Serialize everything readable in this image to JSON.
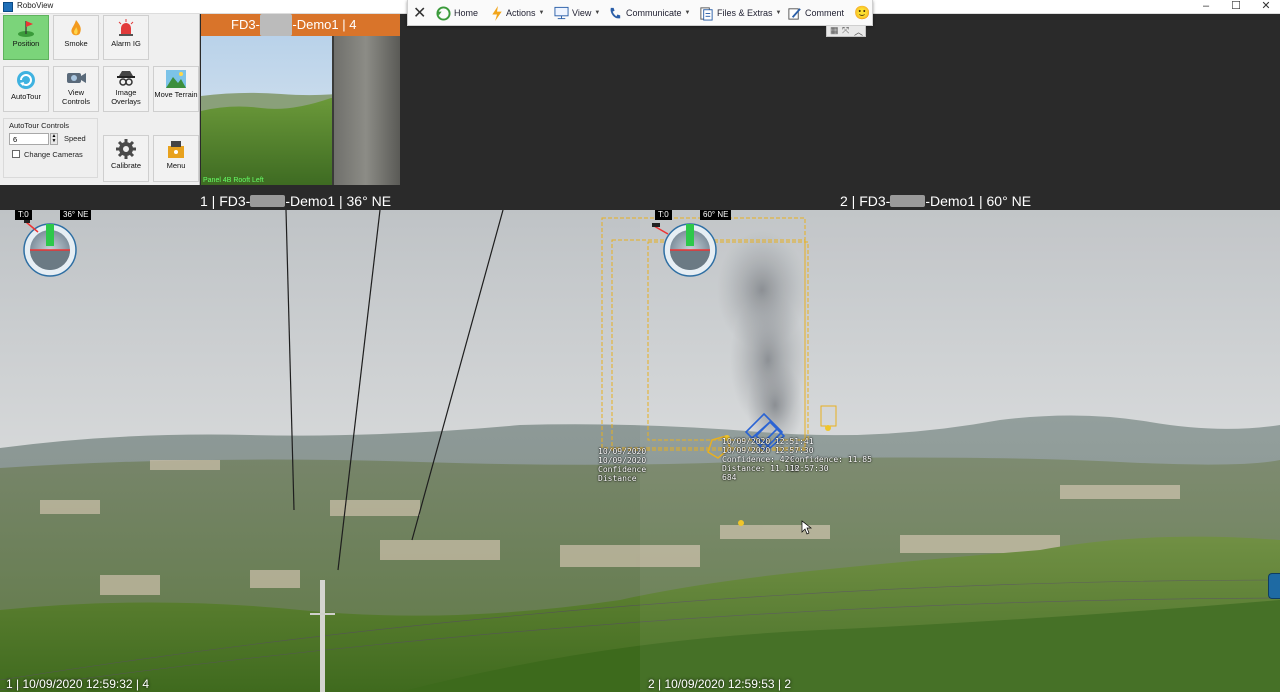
{
  "window": {
    "title": "RoboView",
    "minimize": "–",
    "maximize": "☐",
    "close": "✕"
  },
  "toolbar": {
    "close": "✕",
    "items": [
      {
        "label": "Home",
        "icon": "home-icon"
      },
      {
        "label": "Actions",
        "icon": "lightning-icon"
      },
      {
        "label": "View",
        "icon": "monitor-icon"
      },
      {
        "label": "Communicate",
        "icon": "phone-icon"
      },
      {
        "label": "Files & Extras",
        "icon": "files-icon"
      },
      {
        "label": "Comment",
        "icon": "pen-icon"
      }
    ],
    "emoji": "🙂",
    "sub_controls": [
      "▦",
      "⤧",
      "︿"
    ]
  },
  "panel": {
    "buttons": [
      {
        "label": "Position",
        "icon": "golf-flag-icon",
        "active": true
      },
      {
        "label": "Smoke",
        "icon": "flame-icon"
      },
      {
        "label": "Alarm IG",
        "icon": "siren-icon"
      },
      {
        "label": "AutoTour",
        "icon": "refresh-icon"
      },
      {
        "label": "View Controls",
        "icon": "camera-icon"
      },
      {
        "label": "Image Overlays",
        "icon": "spy-icon"
      },
      {
        "label": "Move Terrain",
        "icon": "landscape-icon"
      },
      {
        "label": "Calibrate",
        "icon": "gear-icon"
      },
      {
        "label": "Menu",
        "icon": "menu-icon"
      }
    ],
    "autotour": {
      "header": "AutoTour Controls",
      "speed_value": "6",
      "speed_label": "Speed",
      "change_cameras_label": "Change Cameras",
      "change_cameras_checked": false
    }
  },
  "preview": {
    "prefix": "FD3-",
    "redacted": "xxxxx",
    "suffix": "-Demo1 | 4",
    "overlay_text": "Panel 4B Rooft Left"
  },
  "cameras": [
    {
      "prefix": "1 | FD3-",
      "redacted": "xxxxx",
      "suffix": "-Demo1 | 36° NE",
      "hud_t": "T:0",
      "hud_dir": "36° NE",
      "footer": "1 | 10/09/2020 12:59:32 | 4"
    },
    {
      "prefix": "2 | FD3-",
      "redacted": "xxxxx",
      "suffix": "-Demo1 | 60° NE",
      "hud_t": "T:0",
      "hud_dir": "60° NE",
      "footer": "2 | 10/09/2020 12:59:53 | 2"
    }
  ],
  "detections": [
    {
      "lines": [
        "10/09/2020",
        "10/09/2020",
        "Confidence",
        "Distance"
      ]
    },
    {
      "lines": [
        "10/09/2020 12:51:41",
        "10/09/2020 12:57:30",
        "Confidence: 42%",
        "Distance: 11.118",
        "684"
      ]
    },
    {
      "lines": [
        "Confidence: 11.85",
        "12:57:30"
      ]
    }
  ],
  "colors": {
    "panel_active": "#7bd47a",
    "preview_header": "#d9742a",
    "detection_box": "#e8b020",
    "detection_marker": "#2a63d4"
  }
}
